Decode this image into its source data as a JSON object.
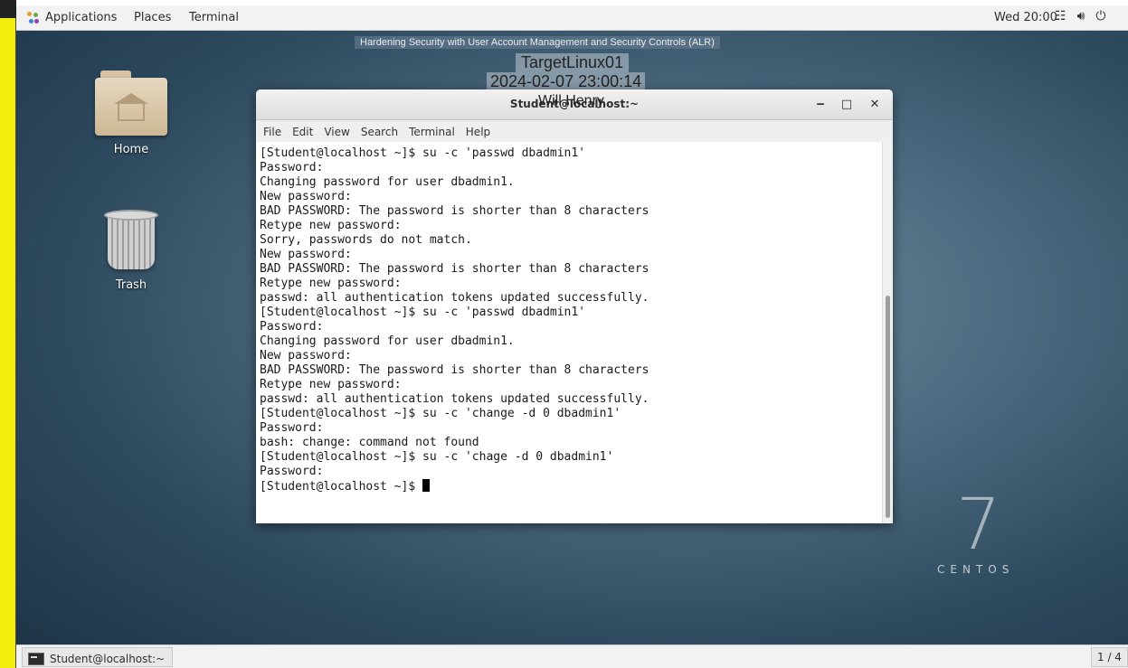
{
  "top_panel": {
    "applications": "Applications",
    "places": "Places",
    "terminal": "Terminal",
    "clock": "Wed 20:00",
    "tray_icons": [
      "network-icon",
      "volume-icon",
      "power-icon"
    ]
  },
  "overlay": {
    "course": "Hardening Security with User Account Management and Security Controls (ALR)",
    "hostname": "TargetLinux01",
    "datetime": "2024-02-07 23:00:14",
    "user": "Will Henry"
  },
  "desktop": {
    "icons": [
      {
        "label": "Home"
      },
      {
        "label": "Trash"
      }
    ]
  },
  "window": {
    "title": "Student@localhost:~",
    "menu": [
      "File",
      "Edit",
      "View",
      "Search",
      "Terminal",
      "Help"
    ],
    "lines": [
      "[Student@localhost ~]$ su -c 'passwd dbadmin1'",
      "Password:",
      "Changing password for user dbadmin1.",
      "New password:",
      "BAD PASSWORD: The password is shorter than 8 characters",
      "Retype new password:",
      "Sorry, passwords do not match.",
      "New password:",
      "BAD PASSWORD: The password is shorter than 8 characters",
      "Retype new password:",
      "passwd: all authentication tokens updated successfully.",
      "[Student@localhost ~]$ su -c 'passwd dbadmin1'",
      "Password:",
      "Changing password for user dbadmin1.",
      "New password:",
      "BAD PASSWORD: The password is shorter than 8 characters",
      "Retype new password:",
      "passwd: all authentication tokens updated successfully.",
      "[Student@localhost ~]$ su -c 'change -d 0 dbadmin1'",
      "Password:",
      "bash: change: command not found",
      "[Student@localhost ~]$ su -c 'chage -d 0 dbadmin1'",
      "Password:"
    ],
    "prompt": "[Student@localhost ~]$ "
  },
  "brand": {
    "number": "7",
    "word": "CENTOS"
  },
  "bottom_panel": {
    "task": "Student@localhost:~",
    "workspace": "1 / 4"
  }
}
